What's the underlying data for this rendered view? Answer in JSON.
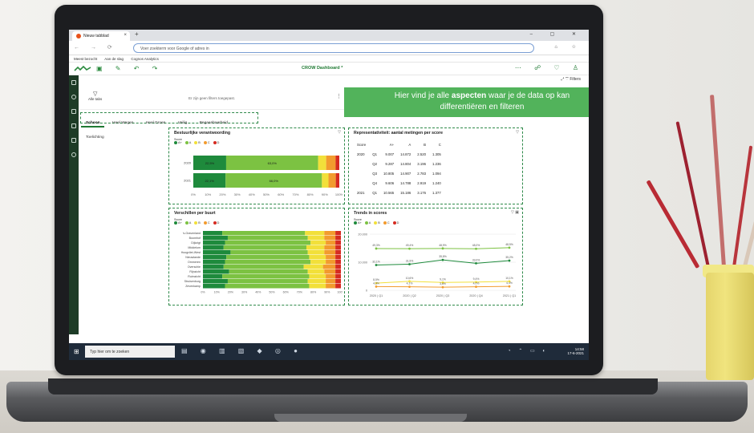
{
  "browser": {
    "tab_title": "Nieuw tabblad",
    "tab_close": "×",
    "new_tab": "+",
    "window_controls": "– ▢ ✕",
    "nav_buttons": "← → ⟳",
    "address_placeholder": "Voer zoekterm voor Google of adres in",
    "address_right": "⌂ ☆",
    "bookmarks": [
      "Meest bezocht",
      "Aan de slag",
      "Cognos Analytics"
    ]
  },
  "app": {
    "header_tools": "▣ ✎ ↶ ↷",
    "title": "CROW Dashboard *",
    "header_right": "⋯ ☍ ♡ ♙",
    "filters_label": "Filters",
    "all_filters_label": "Alle tabs",
    "no_filters_text": "Er zijn geen filters toegepast.",
    "tabs": [
      "Schoon",
      "Heel Wegen",
      "Heel Groen",
      "Veilig",
      "Begaanbaarheid",
      "Toelichting"
    ],
    "active_tab": "Schoon"
  },
  "callout": {
    "prefix": "Hier vind je alle ",
    "bold": "aspecten",
    "suffix": " waar je de data op kan differentiëren en filteren"
  },
  "legend": {
    "title": "Score",
    "items": [
      {
        "label": "A+",
        "color": "#1e8a3c"
      },
      {
        "label": "A",
        "color": "#7cc242"
      },
      {
        "label": "B",
        "color": "#f2e03a"
      },
      {
        "label": "C",
        "color": "#f29b2e"
      },
      {
        "label": "D",
        "color": "#d62b21"
      }
    ]
  },
  "panels": {
    "bestuurlijk": {
      "title": "Bestuurlijke verantwoording",
      "chart_data": {
        "type": "bar",
        "orientation": "horizontal",
        "stacked": true,
        "categories": [
          "2020",
          "2021"
        ],
        "series": [
          {
            "name": "A+",
            "values": [
              22.5,
              22.1
            ]
          },
          {
            "name": "A",
            "values": [
              63.0,
              66.0
            ]
          },
          {
            "name": "B",
            "values": [
              5.5,
              4.5
            ]
          },
          {
            "name": "C",
            "values": [
              6.5,
              5.0
            ]
          },
          {
            "name": "D",
            "values": [
              2.5,
              2.4
            ]
          }
        ],
        "data_labels": [
          "22,5%",
          "63,0%",
          "22,1%",
          "66,0%"
        ],
        "xticks": [
          "0%",
          "10%",
          "20%",
          "30%",
          "40%",
          "50%",
          "60%",
          "70%",
          "80%",
          "90%",
          "100%"
        ],
        "xlim": [
          0,
          100
        ]
      }
    },
    "representativiteit": {
      "title": "Representativiteit: aantal metingen per score",
      "chart_data": {
        "type": "table",
        "columns": [
          "Score",
          "",
          "A+",
          "A",
          "B",
          "C"
        ],
        "rows": [
          [
            "2020",
            "Q1",
            "9.007",
            "14.872",
            "2.520",
            "1.305"
          ],
          [
            "",
            "Q2",
            "9.287",
            "14.804",
            "3.196",
            "1.236"
          ],
          [
            "",
            "Q3",
            "10.805",
            "14.907",
            "2.783",
            "1.094"
          ],
          [
            "",
            "Q4",
            "9.606",
            "14.788",
            "2.919",
            "1.240"
          ],
          [
            "2021",
            "Q1",
            "10.565",
            "15.186",
            "3.176",
            "1.377"
          ]
        ]
      }
    },
    "verschillen": {
      "title": "Verschillen per buurt",
      "chart_data": {
        "type": "bar",
        "orientation": "horizontal",
        "stacked": true,
        "categories": [
          "'s-Gravenland",
          "Boomhof",
          "Dijkzigt",
          "Middelum",
          "Hoogvliet-West",
          "Nieuwlande",
          "Ommeren",
          "Overschie",
          "Rijnzicht",
          "Ruimzicht",
          "Struisenburg",
          "Zevenkamp"
        ],
        "series": [
          {
            "name": "A+",
            "values": [
              14,
              18,
              16,
              15,
              20,
              17,
              16,
              15,
              19,
              14,
              18,
              16
            ]
          },
          {
            "name": "A",
            "values": [
              60,
              58,
              62,
              60,
              56,
              60,
              62,
              58,
              57,
              63,
              58,
              61
            ]
          },
          {
            "name": "B",
            "values": [
              14,
              12,
              11,
              13,
              12,
              12,
              11,
              14,
              12,
              12,
              13,
              12
            ]
          },
          {
            "name": "C",
            "values": [
              8,
              8,
              7,
              8,
              8,
              7,
              7,
              9,
              8,
              7,
              7,
              7
            ]
          },
          {
            "name": "D",
            "values": [
              4,
              4,
              4,
              4,
              4,
              4,
              4,
              4,
              4,
              4,
              4,
              4
            ]
          }
        ],
        "xticks": [
          "0%",
          "10%",
          "20%",
          "30%",
          "40%",
          "50%",
          "60%",
          "70%",
          "80%",
          "90%",
          "100%"
        ],
        "xlim": [
          0,
          100
        ]
      }
    },
    "trends": {
      "title": "Trends in scores",
      "chart_data": {
        "type": "line",
        "x": [
          "2020 | Q1",
          "2020 | Q2",
          "2020 | Q3",
          "2020 | Q4",
          "2021 | Q1"
        ],
        "series": [
          {
            "name": "A+",
            "values": [
              9007,
              9287,
              10805,
              9606,
              10565
            ]
          },
          {
            "name": "A",
            "values": [
              14872,
              14804,
              14907,
              14788,
              15186
            ]
          },
          {
            "name": "B",
            "values": [
              2520,
              3196,
              2783,
              2919,
              3176
            ]
          },
          {
            "name": "C",
            "values": [
              1305,
              1236,
              1094,
              1240,
              1377
            ]
          }
        ],
        "data_labels": [
          [
            "32,1%",
            "31,9%",
            "35,8%",
            "33,0%",
            "35,2%"
          ],
          [
            "49,3%",
            "49,4%",
            "48,9%",
            "48,0%",
            "48,5%"
          ],
          [
            "8,5%",
            "10,6%",
            "9,1%",
            "9,4%",
            "10,1%"
          ],
          [
            "4,3%",
            "4,1%",
            "3,6%",
            "4,0%",
            "4,4%"
          ]
        ],
        "yticks": [
          "0",
          "10.000",
          "20.000"
        ],
        "ylim": [
          0,
          20000
        ]
      }
    }
  },
  "taskbar": {
    "search_placeholder": "Typ hier om te zoeken",
    "time": "14:58",
    "date": "17-6-2021"
  }
}
